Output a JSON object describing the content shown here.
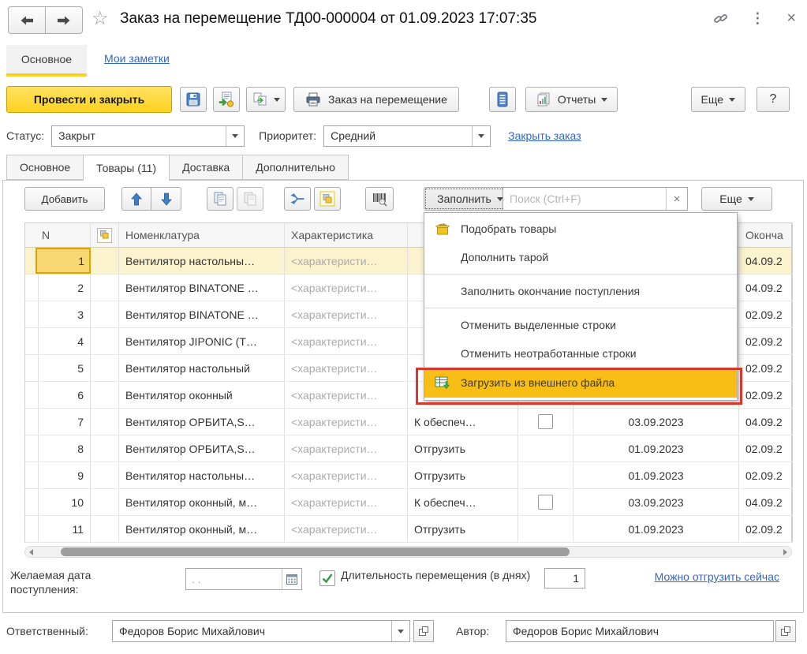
{
  "window": {
    "title": "Заказ на перемещение ТД00-000004 от 01.09.2023 17:07:35"
  },
  "nav": {
    "main_tab": "Основное",
    "notes_link": "Мои заметки"
  },
  "command_bar": {
    "post_and_close": "Провести и закрыть",
    "print_label": "Заказ на перемещение",
    "reports_label": "Отчеты",
    "more_label": "Еще",
    "help_label": "?"
  },
  "status_row": {
    "status_label": "Статус:",
    "status_value": "Закрыт",
    "priority_label": "Приоритет:",
    "priority_value": "Средний",
    "close_order_link": "Закрыть заказ"
  },
  "form_tabs": [
    {
      "label": "Основное"
    },
    {
      "label": "Товары (11)"
    },
    {
      "label": "Доставка"
    },
    {
      "label": "Дополнительно"
    }
  ],
  "table_toolbar": {
    "add_label": "Добавить",
    "fill_label": "Заполнить",
    "search_placeholder": "Поиск (Ctrl+F)",
    "more_label": "Еще"
  },
  "menu": {
    "items": [
      {
        "label": "Подобрать товары",
        "icon": "pick-goods-icon"
      },
      {
        "label": "Дополнить тарой"
      },
      {
        "label": "Заполнить окончание поступления",
        "sep_before": true
      },
      {
        "label": "Отменить выделенные строки",
        "sep_before": true
      },
      {
        "label": "Отменить неотработанные строки"
      },
      {
        "label": "Загрузить из внешнего файла",
        "icon": "load-file-icon",
        "highlighted": true
      }
    ]
  },
  "table": {
    "header": {
      "n": "N",
      "nomenclature": "Номенклатура",
      "characteristic": "Характеристика",
      "end": "Оконча"
    },
    "rows": [
      {
        "n": "1",
        "name": "Вентилятор настольны…",
        "char": "<характеристи…",
        "action": "",
        "has_checkbox": false,
        "date": "",
        "end": "04.09.2",
        "selected": true
      },
      {
        "n": "2",
        "name": "Вентилятор BINATONE …",
        "char": "<характеристи…",
        "action": "",
        "has_checkbox": false,
        "date": "",
        "end": "04.09.2",
        "selected": false
      },
      {
        "n": "3",
        "name": "Вентилятор BINATONE …",
        "char": "<характеристи…",
        "action": "",
        "has_checkbox": false,
        "date": "",
        "end": "02.09.2",
        "selected": false
      },
      {
        "n": "4",
        "name": "Вентилятор JIPONIC (T…",
        "char": "<характеристи…",
        "action": "",
        "has_checkbox": false,
        "date": "",
        "end": "02.09.2",
        "selected": false
      },
      {
        "n": "5",
        "name": "Вентилятор настольный",
        "char": "<характеристи…",
        "action": "",
        "has_checkbox": false,
        "date": "",
        "end": "02.09.2",
        "selected": false
      },
      {
        "n": "6",
        "name": "Вентилятор оконный",
        "char": "<характеристи…",
        "action": "",
        "has_checkbox": false,
        "date": "",
        "end": "02.09.2",
        "selected": false
      },
      {
        "n": "7",
        "name": "Вентилятор ОРБИТА,S…",
        "char": "<характеристи…",
        "action": "К обеспеч…",
        "has_checkbox": true,
        "date": "03.09.2023",
        "end": "04.09.2",
        "selected": false
      },
      {
        "n": "8",
        "name": "Вентилятор ОРБИТА,S…",
        "char": "<характеристи…",
        "action": "Отгрузить",
        "has_checkbox": false,
        "date": "01.09.2023",
        "end": "02.09.2",
        "selected": false
      },
      {
        "n": "9",
        "name": "Вентилятор настольны…",
        "char": "<характеристи…",
        "action": "Отгрузить",
        "has_checkbox": false,
        "date": "01.09.2023",
        "end": "02.09.2",
        "selected": false
      },
      {
        "n": "10",
        "name": "Вентилятор оконный, м…",
        "char": "<характеристи…",
        "action": "К обеспеч…",
        "has_checkbox": true,
        "date": "03.09.2023",
        "end": "04.09.2",
        "selected": false
      },
      {
        "n": "11",
        "name": "Вентилятор оконный, м…",
        "char": "<характеристи…",
        "action": "Отгрузить",
        "has_checkbox": false,
        "date": "01.09.2023",
        "end": "02.09.2",
        "selected": false
      }
    ]
  },
  "footer": {
    "desired_date_label": "Желаемая дата поступления:",
    "date_placeholder": ". .",
    "duration_label": "Длительность перемещения (в днях)",
    "duration_value": "1",
    "ship_now_link": "Можно отгрузить сейчас"
  },
  "bottom": {
    "responsible_label": "Ответственный:",
    "responsible_value": "Федоров Борис Михайлович",
    "author_label": "Автор:",
    "author_value": "Федоров Борис Михайлович"
  },
  "colors": {
    "accent_yellow": "#ffd11f",
    "menu_highlight": "#f8be15",
    "annotation_red": "#d6382c",
    "link_blue": "#3366cc",
    "selected_row": "#fbf2ce",
    "current_cell_border": "#e0a400"
  }
}
